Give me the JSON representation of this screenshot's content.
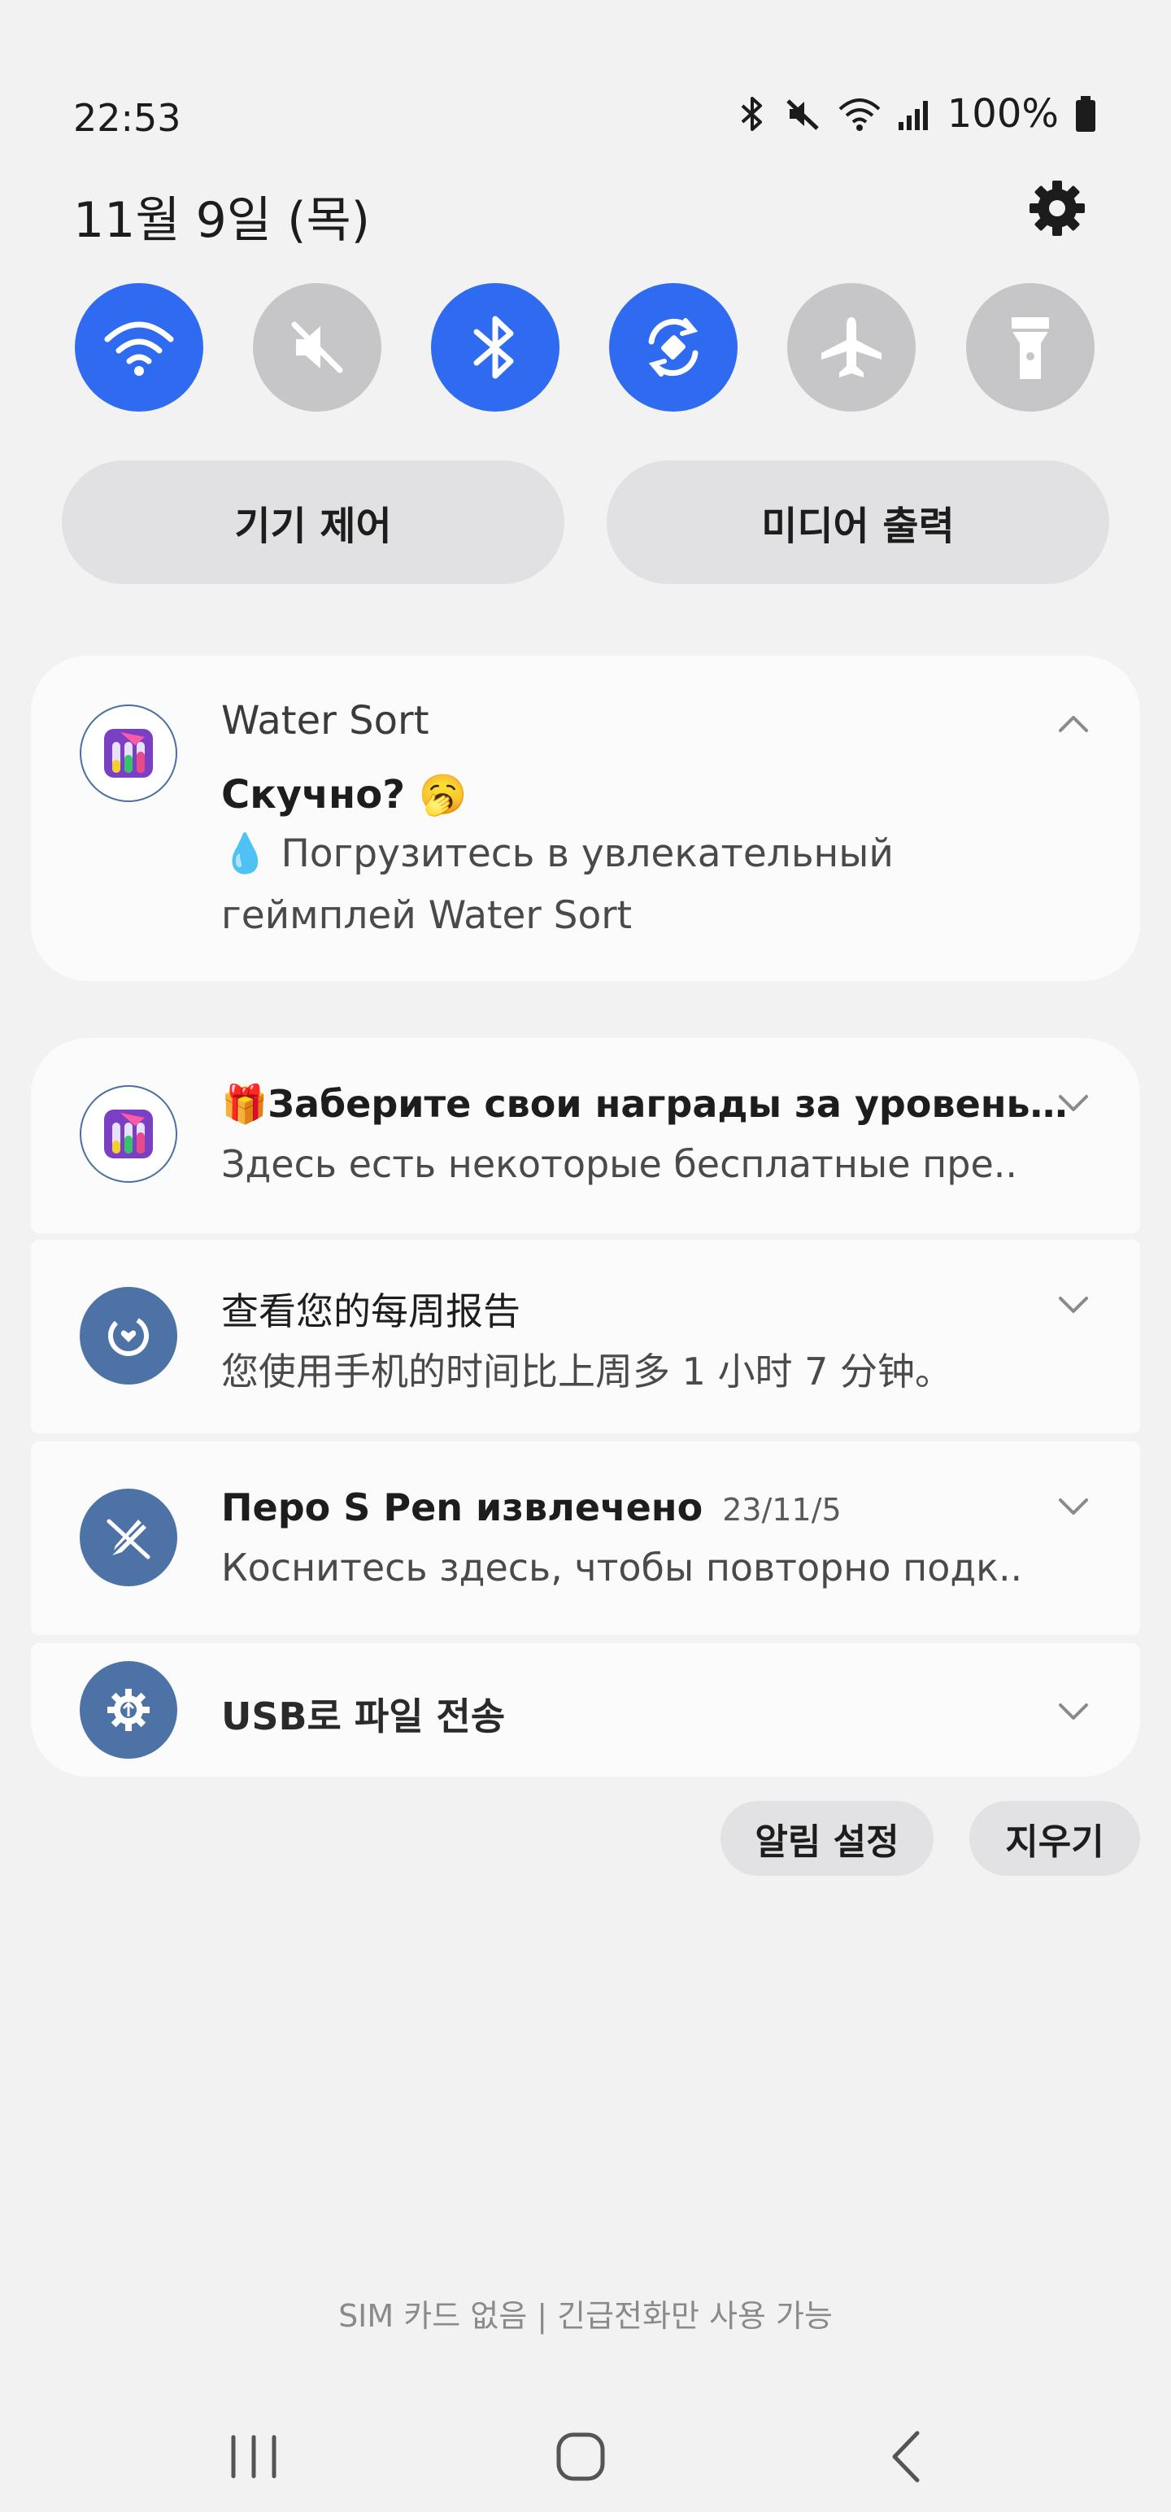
{
  "status_bar": {
    "time": "22:53",
    "battery_percent": "100%",
    "icons": [
      "bluetooth-icon",
      "mute-icon",
      "wifi-icon",
      "signal-icon",
      "battery-icon"
    ]
  },
  "header": {
    "date": "11월 9일 (목)",
    "settings_icon": "gear-icon"
  },
  "quick_settings": {
    "toggles": [
      {
        "name": "wifi",
        "icon": "wifi-icon",
        "on": true
      },
      {
        "name": "sound",
        "icon": "mute-icon",
        "on": false
      },
      {
        "name": "bluetooth",
        "icon": "bluetooth-icon",
        "on": true
      },
      {
        "name": "auto-rotate",
        "icon": "rotate-icon",
        "on": true
      },
      {
        "name": "airplane",
        "icon": "airplane-icon",
        "on": false
      },
      {
        "name": "flashlight",
        "icon": "flashlight-icon",
        "on": false
      }
    ],
    "device_control_label": "기기 제어",
    "media_output_label": "미디어 출력"
  },
  "notifications": {
    "water_sort": {
      "app_name": "Water Sort",
      "title": "Скучно? 🥱",
      "body_line1": "💧 Погрузитесь в увлекательный",
      "body_line2": "геймплей Water Sort"
    },
    "rewards": {
      "title": "🎁Заберите свои награды за уровень…",
      "body": "Здесь есть некоторые бесплатные пре.."
    },
    "weekly_report": {
      "title": "查看您的每周报告",
      "body": "您使用手机的时间比上周多 1 小时 7 分钟。"
    },
    "spen": {
      "title": "Перо S Pen извлечено",
      "date": "23/11/5",
      "body": "Коснитесь здесь, чтобы повторно подк.."
    },
    "usb": {
      "title": "USB로 파일 전송"
    }
  },
  "actions": {
    "notification_settings": "알림 설정",
    "clear": "지우기"
  },
  "footer": {
    "sim_status": "SIM 카드 없음 | 긴급전화만 사용 가능"
  },
  "colors": {
    "accent": "#2f6bf0",
    "toggle_off": "#c6c6c8",
    "system_icon": "#4d72a6",
    "background": "#f2f2f3"
  }
}
